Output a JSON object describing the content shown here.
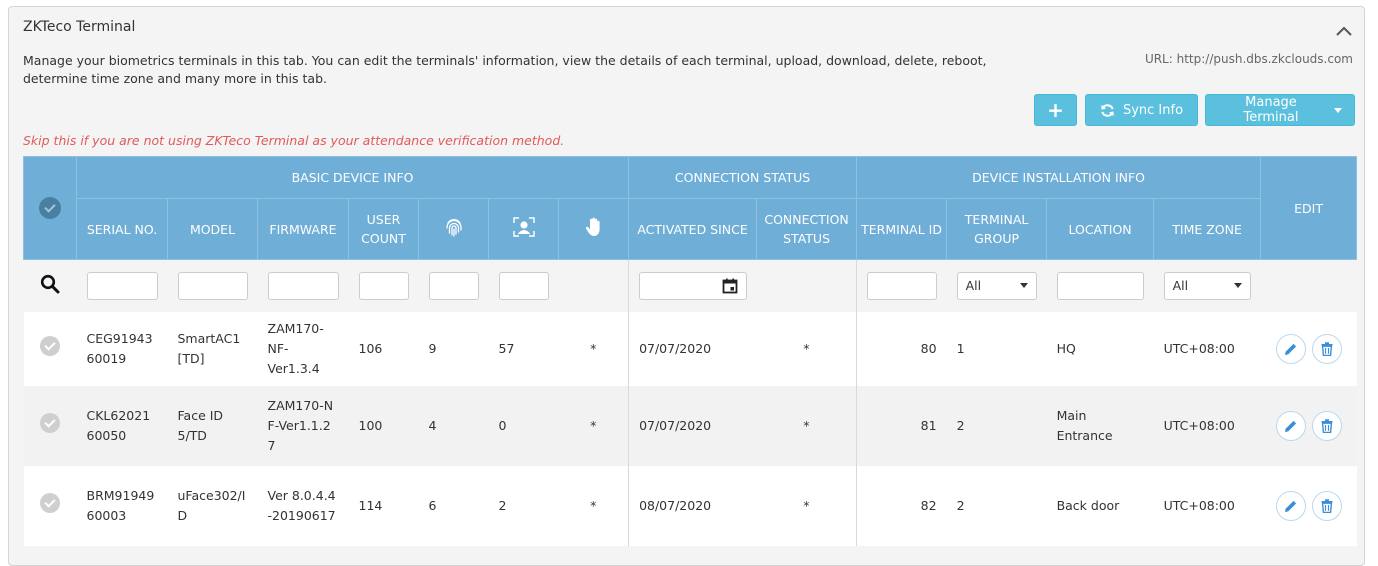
{
  "panel": {
    "title": "ZKTeco Terminal",
    "description": "Manage your biometrics terminals in this tab. You can edit the terminals' information, view the details of each terminal, upload, download, delete, reboot, determine time zone and many more in this tab.",
    "url": "URL: http://push.dbs.zkclouds.com",
    "warning": "Skip this if you are not using ZKTeco Terminal as your attendance verification method."
  },
  "toolbar": {
    "add_label": "+",
    "sync_label": "Sync Info",
    "manage_label": "Manage Terminal"
  },
  "table": {
    "groups": {
      "basic": "BASIC DEVICE INFO",
      "connection": "CONNECTION STATUS",
      "installation": "DEVICE INSTALLATION INFO",
      "edit": "EDIT"
    },
    "columns": {
      "serial": "SERIAL NO.",
      "model": "MODEL",
      "firmware": "FIRMWARE",
      "user_count": "USER COUNT",
      "activated": "ACTIVATED SINCE",
      "conn_status": "CONNECTION STATUS",
      "terminal_id": "TERMINAL ID",
      "terminal_group": "TERMINAL GROUP",
      "location": "LOCATION",
      "time_zone": "TIME ZONE"
    },
    "column_icons": [
      "fingerprint-icon",
      "face-icon",
      "palm-icon"
    ],
    "filters": {
      "terminal_group": "All",
      "time_zone": "All"
    },
    "rows": [
      {
        "serial": "CEG9194360019",
        "model": "SmartAC1[TD]",
        "firmware": "ZAM170-NF-Ver1.3.4",
        "user_count": "106",
        "fingerprint": "9",
        "face": "57",
        "palm": "*",
        "activated": "07/07/2020",
        "conn_status": "*",
        "terminal_id": "80",
        "terminal_group": "1",
        "location": "HQ",
        "time_zone": "UTC+08:00"
      },
      {
        "serial": "CKL6202160050",
        "model": "Face ID 5/TD",
        "firmware": "ZAM170-NF-Ver1.1.27",
        "user_count": "100",
        "fingerprint": "4",
        "face": "0",
        "palm": "*",
        "activated": "07/07/2020",
        "conn_status": "*",
        "terminal_id": "81",
        "terminal_group": "2",
        "location": "Main Entrance",
        "time_zone": "UTC+08:00"
      },
      {
        "serial": "BRM9194960003",
        "model": "uFace302/ID",
        "firmware": "Ver 8.0.4.4-20190617",
        "user_count": "114",
        "fingerprint": "6",
        "face": "2",
        "palm": "*",
        "activated": "08/07/2020",
        "conn_status": "*",
        "terminal_id": "82",
        "terminal_group": "2",
        "location": "Back door",
        "time_zone": "UTC+08:00"
      }
    ]
  },
  "colors": {
    "header_blue": "#6faed6",
    "button_blue": "#5bc0de",
    "warning_red": "#e05a5a"
  }
}
